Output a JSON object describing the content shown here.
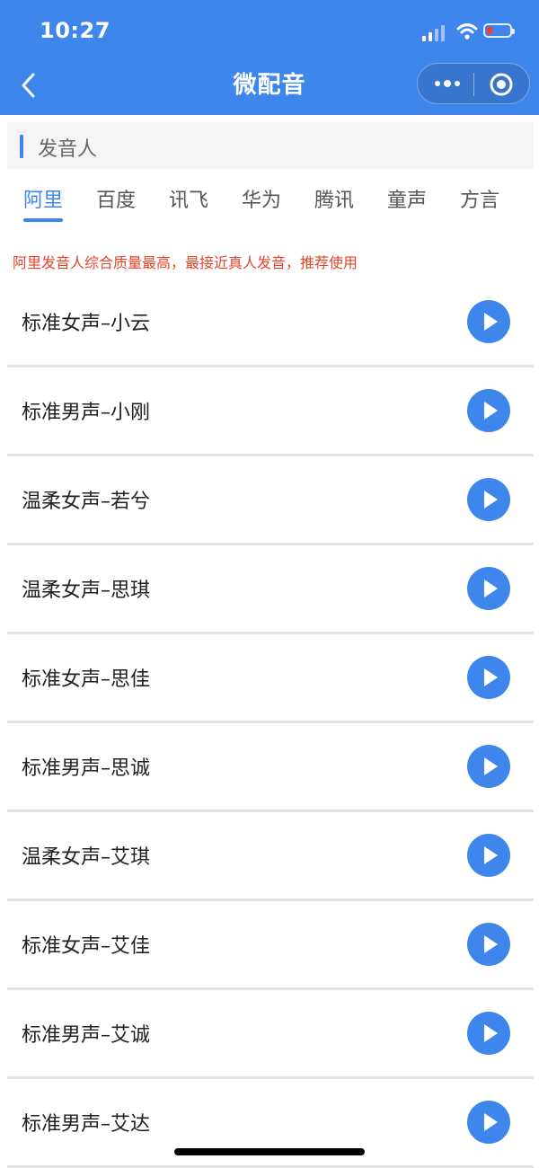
{
  "status": {
    "time": "10:27"
  },
  "nav": {
    "title": "微配音"
  },
  "section": {
    "title": "发音人"
  },
  "tabs": [
    {
      "label": "阿里",
      "active": true
    },
    {
      "label": "百度",
      "active": false
    },
    {
      "label": "讯飞",
      "active": false
    },
    {
      "label": "华为",
      "active": false
    },
    {
      "label": "腾讯",
      "active": false
    },
    {
      "label": "童声",
      "active": false
    },
    {
      "label": "方言",
      "active": false
    }
  ],
  "tip": "阿里发音人综合质量最高，最接近真人发音，推荐使用",
  "voices": [
    {
      "name": "标准女声–小云"
    },
    {
      "name": "标准男声–小刚"
    },
    {
      "name": "温柔女声–若兮"
    },
    {
      "name": "温柔女声–思琪"
    },
    {
      "name": "标准女声–思佳"
    },
    {
      "name": "标准男声–思诚"
    },
    {
      "name": "温柔女声–艾琪"
    },
    {
      "name": "标准女声–艾佳"
    },
    {
      "name": "标准男声–艾诚"
    },
    {
      "name": "标准男声–艾达"
    }
  ],
  "colors": {
    "accent": "#3f86ec",
    "tip": "#e5442a",
    "battery_low": "#ff3b30"
  },
  "icons": {
    "back": "chevron-left-icon",
    "more": "more-dots-icon",
    "close": "capsule-close-icon",
    "play": "play-icon"
  }
}
